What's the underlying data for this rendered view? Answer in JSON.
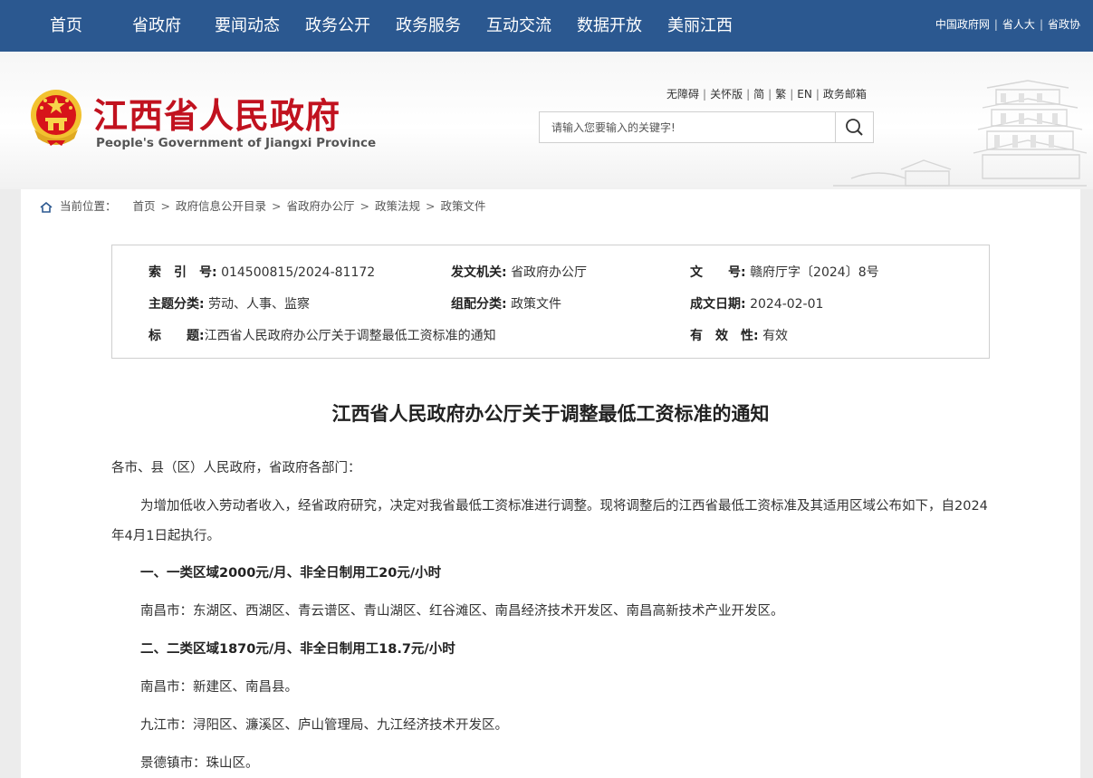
{
  "topnav": {
    "items": [
      "首页",
      "省政府",
      "要闻动态",
      "政务公开",
      "政务服务",
      "互动交流",
      "数据开放",
      "美丽江西"
    ],
    "links": [
      "中国政府网",
      "省人大",
      "省政协"
    ]
  },
  "header": {
    "title": "江西省人民政府",
    "subtitle": "People's Government of Jiangxi Province",
    "util_links": [
      "无障碍",
      "关怀版",
      "简",
      "繁",
      "EN",
      "政务邮箱"
    ],
    "search_placeholder": "请输入您要输入的关键字!"
  },
  "breadcrumb": {
    "label": "当前位置：",
    "items": [
      "首页",
      "政府信息公开目录",
      "省政府办公厅",
      "政策法规",
      "政策文件"
    ]
  },
  "meta": {
    "index_label": "索　引　号:",
    "index_value": "014500815/2024-81172",
    "issuer_label": "发文机关:",
    "issuer_value": "省政府办公厅",
    "docno_label": "文　　号:",
    "docno_value": "赣府厅字〔2024〕8号",
    "topic_label": "主题分类:",
    "topic_value": "劳动、人事、监察",
    "category_label": "组配分类:",
    "category_value": "政策文件",
    "date_label": "成文日期:",
    "date_value": "2024-02-01",
    "title_label": "标　　题:",
    "title_value": "江西省人民政府办公厅关于调整最低工资标准的通知",
    "validity_label": "有　效　性:",
    "validity_value": "有效"
  },
  "article": {
    "title": "江西省人民政府办公厅关于调整最低工资标准的通知",
    "salutation": "各市、县（区）人民政府，省政府各部门：",
    "intro": "为增加低收入劳动者收入，经省政府研究，决定对我省最低工资标准进行调整。现将调整后的江西省最低工资标准及其适用区域公布如下，自2024年4月1日起执行。",
    "sec1_heading": "一、一类区域2000元/月、非全日制用工20元/小时",
    "sec1_nanchang": "南昌市：东湖区、西湖区、青云谱区、青山湖区、红谷滩区、南昌经济技术开发区、南昌高新技术产业开发区。",
    "sec2_heading": "二、二类区域1870元/月、非全日制用工18.7元/小时",
    "sec2_nanchang": "南昌市：新建区、南昌县。",
    "sec2_jiujiang": "九江市：浔阳区、濂溪区、庐山管理局、九江经济技术开发区。",
    "sec2_jingdezhen": "景德镇市：珠山区。"
  },
  "colors": {
    "nav_bg": "#2b5890",
    "title_red": "#c1121f",
    "emblem_gold": "#f2c230"
  },
  "icons": [
    "national-emblem-icon",
    "search-icon",
    "home-icon",
    "pagoda-watermark"
  ]
}
